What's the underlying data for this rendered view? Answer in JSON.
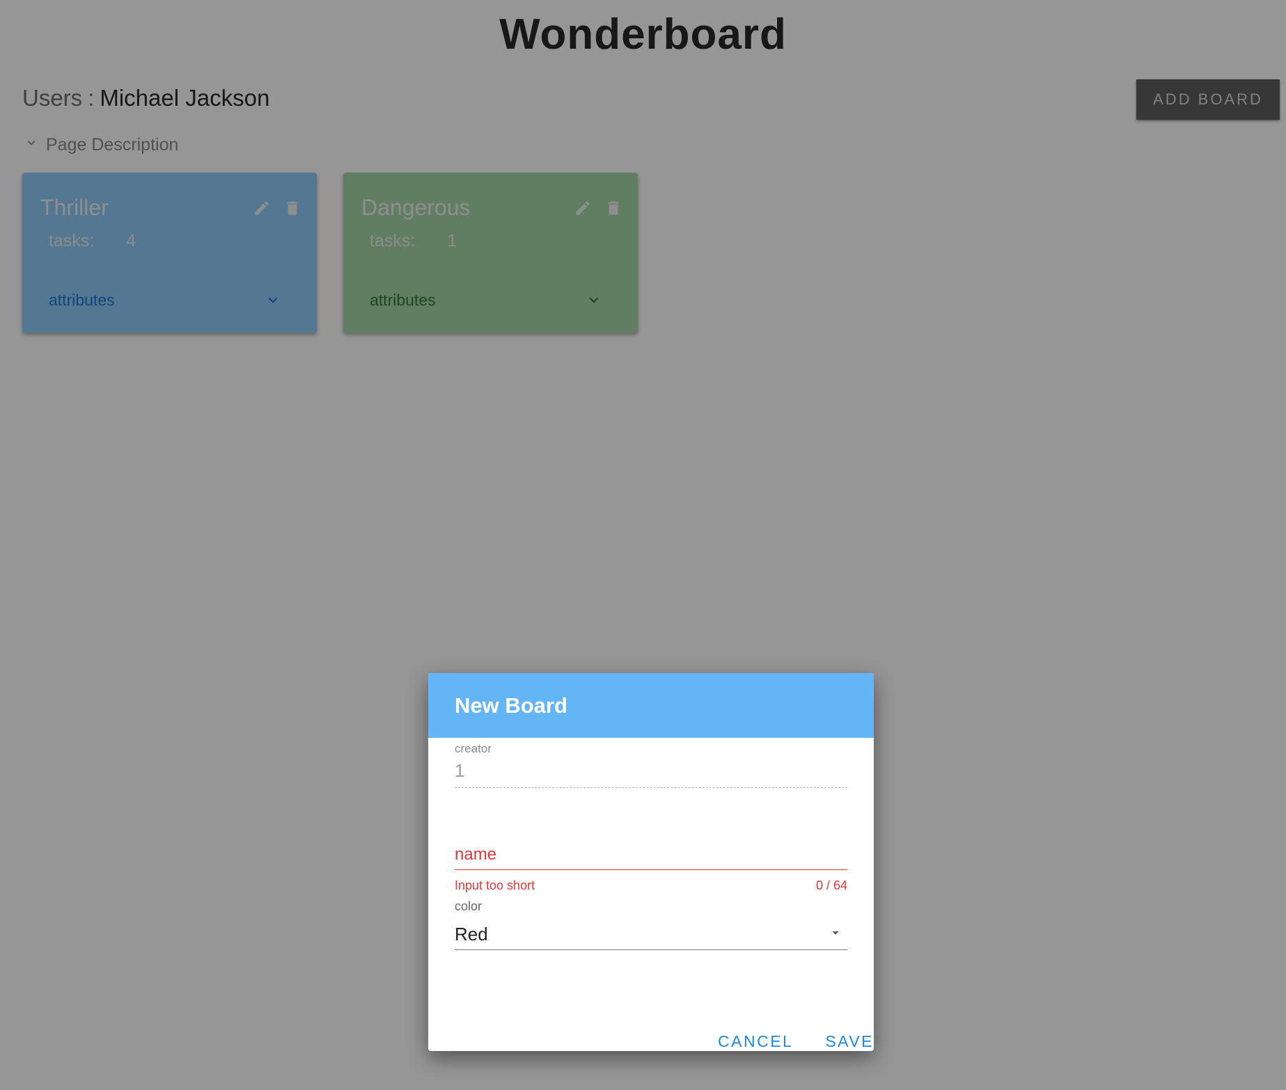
{
  "app": {
    "title": "Wonderboard"
  },
  "user": {
    "label": "Users",
    "separator": ":",
    "name": "Michael Jackson"
  },
  "toolbar": {
    "add_board_label": "ADD BOARD"
  },
  "page_description": {
    "label": "Page Description"
  },
  "boards": [
    {
      "title": "Thriller",
      "tasks_label": "tasks:",
      "tasks_count": "4",
      "attributes_label": "attributes",
      "color": "#90caf9"
    },
    {
      "title": "Dangerous",
      "tasks_label": "tasks:",
      "tasks_count": "1",
      "attributes_label": "attributes",
      "color": "#a5d6a7"
    }
  ],
  "dialog": {
    "title": "New Board",
    "creator": {
      "label": "creator",
      "value": "1"
    },
    "name": {
      "label": "name",
      "error": "Input too short",
      "counter": "0 / 64"
    },
    "color": {
      "label": "color",
      "selected": "Red"
    },
    "cancel_label": "CANCEL",
    "save_label": "SAVE",
    "header_color": "#64b5f6"
  },
  "icons": {
    "edit": "pencil-icon",
    "delete": "trash-icon",
    "expand": "chevron-down-icon",
    "dropdown": "arrow-drop-down-icon"
  }
}
